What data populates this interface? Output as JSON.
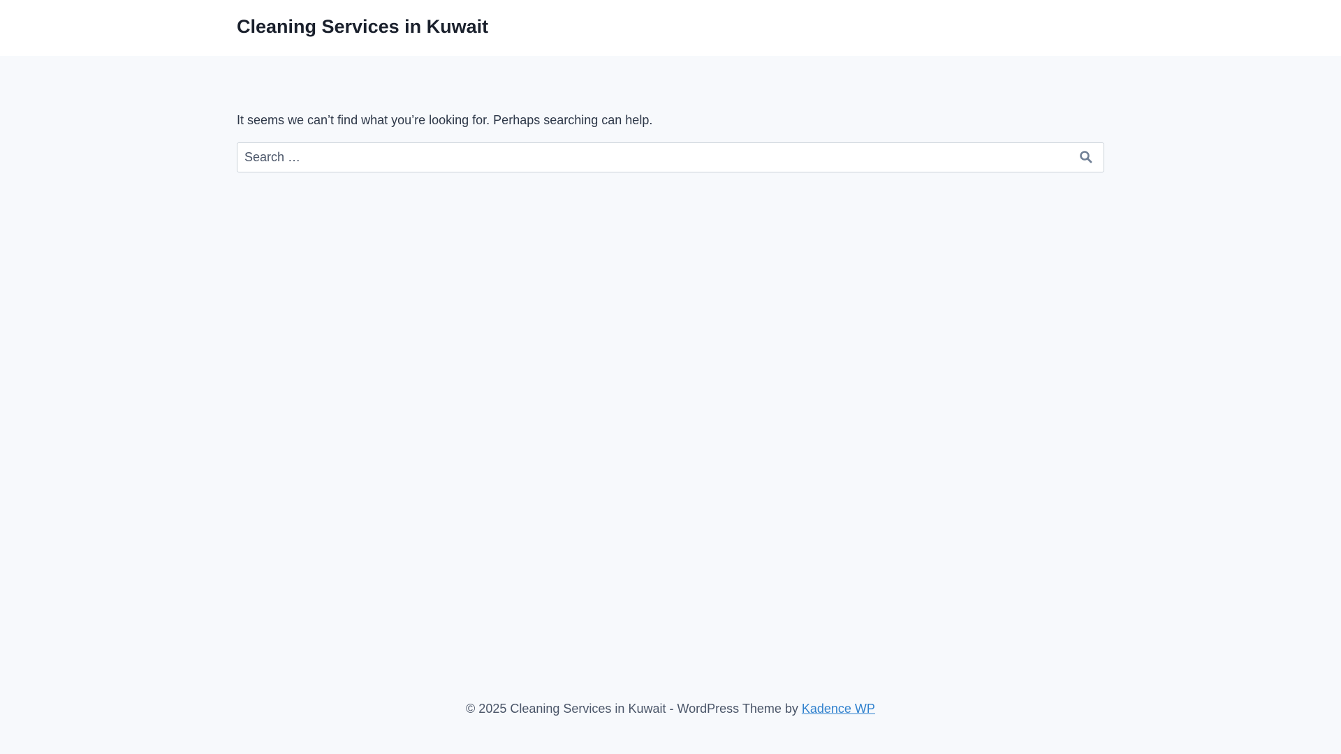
{
  "header": {
    "site_title": "Cleaning Services in Kuwait"
  },
  "main": {
    "message": "It seems we can’t find what you’re looking for. Perhaps searching can help.",
    "search": {
      "placeholder": "Search …",
      "value": "",
      "button_icon": "search-icon"
    }
  },
  "footer": {
    "text": "© 2025 Cleaning Services in Kuwait - WordPress Theme by ",
    "link_label": "Kadence WP"
  }
}
